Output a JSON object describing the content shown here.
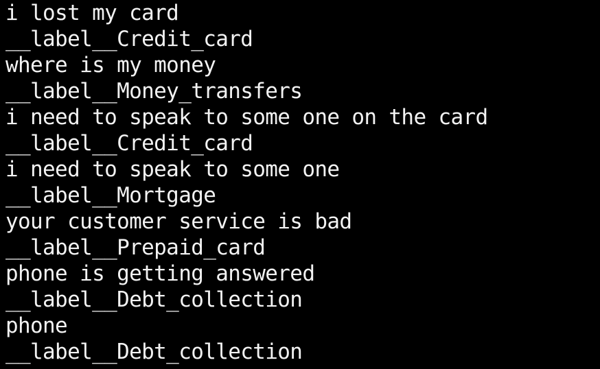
{
  "terminal": {
    "background_color": "#000000",
    "text_color": "#f2f2f2",
    "label_prefix": "__label__",
    "lines": [
      {
        "kind": "text",
        "content": "i lost my card"
      },
      {
        "kind": "label",
        "content": "__label__Credit_card"
      },
      {
        "kind": "text",
        "content": "where is my money"
      },
      {
        "kind": "label",
        "content": "__label__Money_transfers"
      },
      {
        "kind": "text",
        "content": "i need to speak to some one on the card"
      },
      {
        "kind": "label",
        "content": "__label__Credit_card"
      },
      {
        "kind": "text",
        "content": "i need to speak to some one"
      },
      {
        "kind": "label",
        "content": "__label__Mortgage"
      },
      {
        "kind": "text",
        "content": "your customer service is bad"
      },
      {
        "kind": "label",
        "content": "__label__Prepaid_card"
      },
      {
        "kind": "text",
        "content": "phone is getting answered"
      },
      {
        "kind": "label",
        "content": "__label__Debt_collection"
      },
      {
        "kind": "text",
        "content": "phone"
      },
      {
        "kind": "label",
        "content": "__label__Debt_collection"
      }
    ]
  }
}
